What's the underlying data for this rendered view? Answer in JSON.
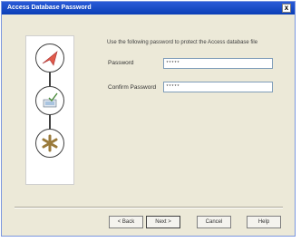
{
  "window": {
    "title": "Access Database Password",
    "close_glyph": "x"
  },
  "sidebar": {
    "steps": [
      {
        "icon": "red-arrow-icon"
      },
      {
        "icon": "computer-check-icon"
      },
      {
        "icon": "asterisk-icon"
      }
    ]
  },
  "main": {
    "instruction": "Use the following password to protect the Access database file",
    "password_label": "Password",
    "password_value": "*****",
    "confirm_label": "Confirm Password",
    "confirm_value": "*****"
  },
  "buttons": {
    "back": "< Back",
    "next": "Next >",
    "cancel": "Cancel",
    "help": "Help"
  },
  "colors": {
    "title_bar": "#0a3fb6",
    "dialog_bg": "#ece9d8",
    "arrow": "#e05a4a"
  }
}
